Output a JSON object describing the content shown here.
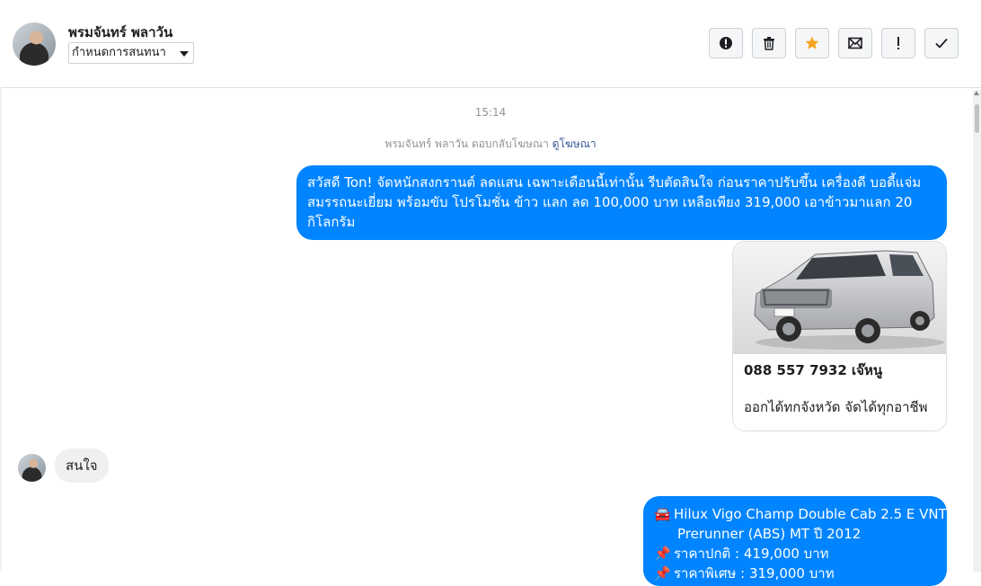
{
  "header": {
    "contact_name": "พรมจันทร์ พลาวัน",
    "assign_label": "กำหนดการสนทนา",
    "actions": [
      {
        "name": "spam-button",
        "icon": "alert-circle-icon"
      },
      {
        "name": "delete-button",
        "icon": "trash-icon"
      },
      {
        "name": "star-button",
        "icon": "star-icon"
      },
      {
        "name": "mark-unread-button",
        "icon": "envelope-icon"
      },
      {
        "name": "important-button",
        "icon": "exclamation-icon"
      },
      {
        "name": "done-button",
        "icon": "check-icon"
      }
    ],
    "accent_color": "#f5a623"
  },
  "conversation": {
    "timestamp": "15:14",
    "ad_reply_text": "พรมจันทร์ พลาวัน ตอบกลับโฆษณา",
    "ad_reply_link": "ดูโฆษณา",
    "outgoing_bubble_color": "#0084ff",
    "incoming_bubble_color": "#f1f0f0",
    "msg1": "สวัสดี Ton!  จัดหนักสงกรานต์ ลดแสน เฉพาะเดือนนี้เท่านั้น รีบตัดสินใจ ก่อนราคาปรับขึ้น เครื่องดี บอดี้แจ่ม สมรรถนะเยี่ยม พร้อมขับ โปรโมชั่น ข้าว แลก ลด 100,000 บาท เหลือเพียง 319,000 เอาข้าวมาแลก 20 กิโลกรัม",
    "card": {
      "image": "silver-pickup-truck-photo",
      "title": "088 557 7932 เจ๊หนู",
      "subtitle": "ออกได้ทกจังหวัด จัดได้ทุกอาชีพ"
    },
    "reply": "สนใจ",
    "msg3": {
      "line1": "Hilux Vigo Champ Double Cab 2.5 E VNT",
      "line2": "Prerunner (ABS) MT ปี 2012",
      "line3": "ราคาปกติ : 419,000 บาท",
      "line4": "ราคาพิเศษ : 319,000 บาท",
      "icons": [
        "car-emoji-icon",
        "pushpin-emoji-icon",
        "pushpin-emoji-icon"
      ]
    }
  }
}
